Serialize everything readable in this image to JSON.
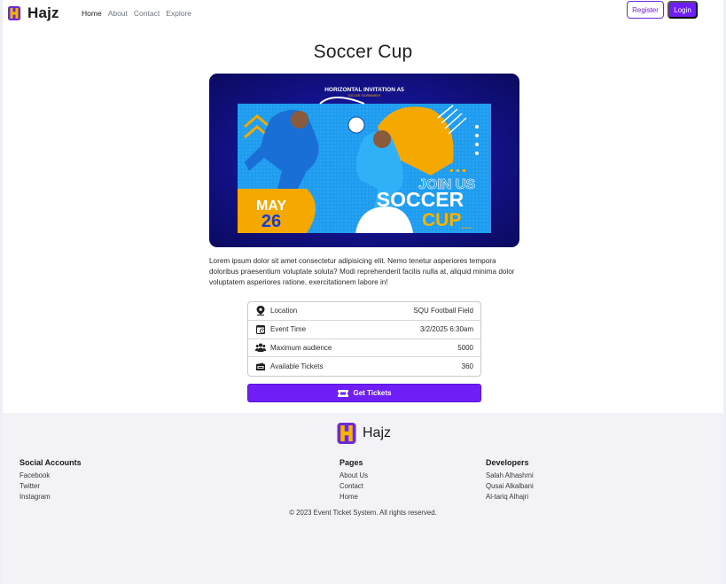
{
  "navbar": {
    "brand": "Hajz",
    "links": [
      {
        "label": "Home",
        "active": true
      },
      {
        "label": "About",
        "active": false
      },
      {
        "label": "Contact",
        "active": false
      },
      {
        "label": "Explore",
        "active": false
      }
    ],
    "register_label": "Register",
    "login_label": "Login"
  },
  "event": {
    "title": "Soccer Cup",
    "poster": {
      "header": "HORIZONTAL INVITATION A5",
      "subheader": "SOCCER TOURNAMENT",
      "month": "MAY",
      "day": "26",
      "join": "JOIN US",
      "line1": "SOCCER",
      "line2": "CUP_"
    },
    "description": "Lorem ipsum dolor sit amet consectetur adipisicing elit. Nemo tenetur asperiores tempora doloribus praesentium voluptate soluta? Modi reprehenderit facilis nulla at, aliquid minima dolor voluptatem asperiores ratione, exercitationem labore in!",
    "details": [
      {
        "icon": "location-icon",
        "label": "Location",
        "value": "SQU Football Field"
      },
      {
        "icon": "calendar-clock-icon",
        "label": "Event Time",
        "value": "3/2/2025 6:30am"
      },
      {
        "icon": "audience-icon",
        "label": "Maximum audience",
        "value": "5000"
      },
      {
        "icon": "tickets-icon",
        "label": "Available Tickets",
        "value": "360"
      }
    ],
    "get_tickets_label": "Get Tickets"
  },
  "footer": {
    "brand": "Hajz",
    "social": {
      "heading": "Social Accounts",
      "items": [
        "Facebook",
        "Twitter",
        "Instagram"
      ]
    },
    "pages": {
      "heading": "Pages",
      "items": [
        "About Us",
        "Contact",
        "Home"
      ]
    },
    "developers": {
      "heading": "Developers",
      "items": [
        "Salah Alhashmi",
        "Qusai Alkalbani",
        "Al-tariq Alhajri"
      ]
    },
    "copyright": "© 2023 Event Ticket System. All rights reserved."
  },
  "colors": {
    "primary": "#6f1ef6",
    "logo_purple": "#6c2bd9",
    "logo_yellow": "#f5b400",
    "poster_blue": "#13128a",
    "footer_bg": "#f3f3f7"
  }
}
